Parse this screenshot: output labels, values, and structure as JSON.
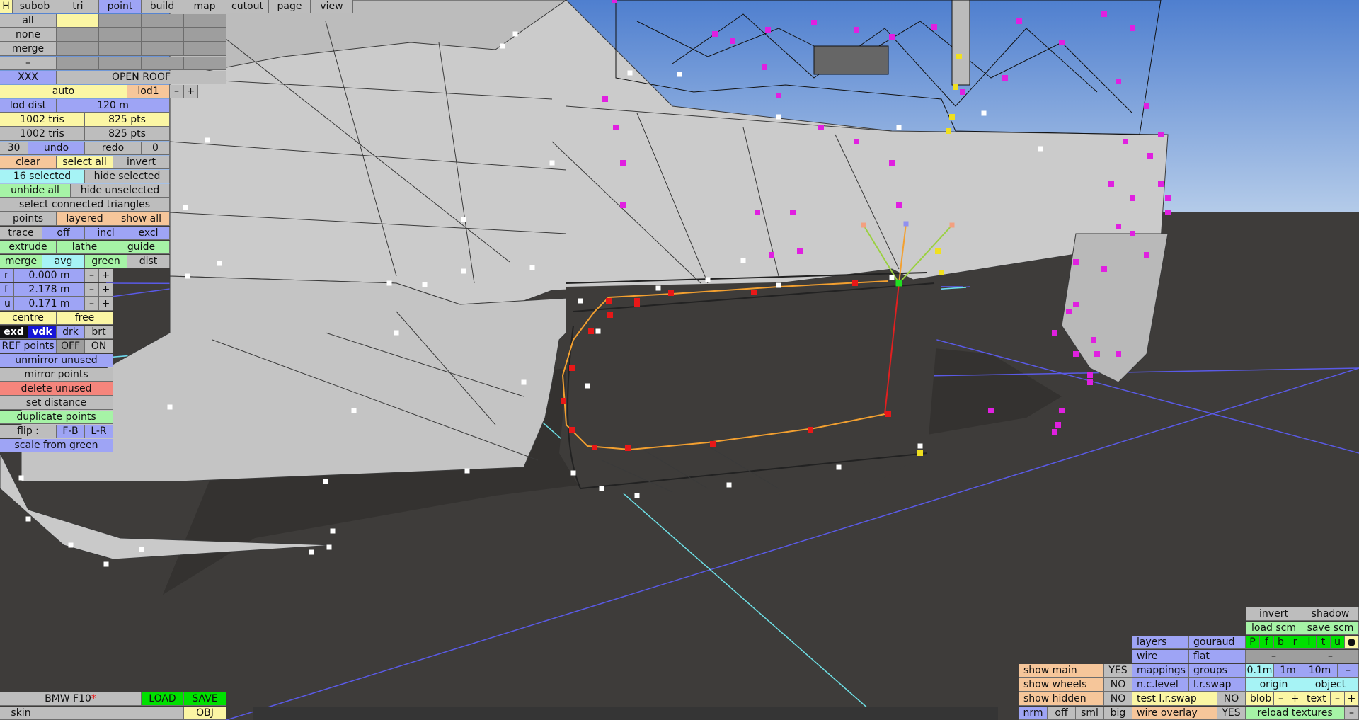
{
  "menu": {
    "h": "H",
    "tabs": [
      "subob",
      "tri",
      "point",
      "build",
      "map",
      "cutout",
      "page",
      "view"
    ]
  },
  "left": {
    "all": "all",
    "none": "none",
    "merge": "merge",
    "dash": "–",
    "xxx": "XXX",
    "open_roof": "OPEN ROOF",
    "auto": "auto",
    "lod1": "lod1",
    "minus": "–",
    "plus": "+",
    "lod_dist": "lod dist",
    "lod_dist_val": "120 m",
    "tris1": "1002 tris",
    "pts1": "825 pts",
    "tris2": "1002 tris",
    "pts2": "825 pts",
    "undo_count": "30",
    "undo": "undo",
    "redo": "redo",
    "redo_count": "0",
    "clear": "clear",
    "select_all": "select all",
    "invert": "invert",
    "selected": "16 selected",
    "hide_selected": "hide selected",
    "unhide_all": "unhide all",
    "hide_unselected": "hide unselected",
    "select_connected": "select connected triangles",
    "points": "points",
    "layered": "layered",
    "show_all": "show all",
    "trace": "trace",
    "off": "off",
    "incl": "incl",
    "excl": "excl",
    "extrude": "extrude",
    "lathe": "lathe",
    "guide": "guide",
    "merge2": "merge",
    "avg": "avg",
    "green": "green",
    "dist": "dist",
    "r": "r",
    "r_val": "0.000 m",
    "f": "f",
    "f_val": "2.178 m",
    "u": "u",
    "u_val": "0.171 m",
    "centre": "centre",
    "free": "free",
    "exd": "exd",
    "vdk": "vdk",
    "drk": "drk",
    "brt": "brt",
    "ref_points": "REF points",
    "ref_off": "OFF",
    "ref_on": "ON",
    "unmirror_unused": "unmirror unused",
    "mirror_points": "mirror points",
    "delete_unused": "delete unused",
    "set_distance": "set distance",
    "duplicate_points": "duplicate points",
    "flip": "flip :",
    "fb": "F-B",
    "lr": "L-R",
    "scale_from_green": "scale from green"
  },
  "bottom_left": {
    "car_name": "BMW F10",
    "star": "*",
    "load": "LOAD",
    "save": "SAVE",
    "skin": "skin",
    "obj": "OBJ"
  },
  "bottom_right": {
    "invert": "invert",
    "shadow": "shadow",
    "load_scm": "load scm",
    "save_scm": "save scm",
    "layers": "layers",
    "gouraud": "gouraud",
    "layer_buttons": [
      "P",
      "f",
      "b",
      "r",
      "l",
      "t",
      "u",
      "●"
    ],
    "wire": "wire",
    "flat": "flat",
    "dash": "–",
    "show_main": "show main",
    "show_main_val": "YES",
    "mappings": "mappings",
    "groups": "groups",
    "m01": "0.1m",
    "m1": "1m",
    "m10": "10m",
    "show_wheels": "show wheels",
    "show_wheels_val": "NO",
    "nc_level": "n.c.level",
    "lr_swap": "l.r.swap",
    "origin": "origin",
    "object": "object",
    "show_hidden": "show hidden",
    "show_hidden_val": "NO",
    "test_lr_swap": "test l.r.swap",
    "test_lr_swap_val": "NO",
    "blob": "blob",
    "text": "text",
    "minus": "–",
    "plus": "+",
    "nrm": "nrm",
    "off": "off",
    "sml": "sml",
    "big": "big",
    "wire_overlay": "wire overlay",
    "wire_overlay_val": "YES",
    "reload_textures": "reload textures"
  },
  "colors": {
    "grey": "#bdbdbd",
    "blue": "#9ea4f5",
    "yellow": "#fbf6a4",
    "orange": "#f6c69a",
    "cyan": "#a6f3f5",
    "green": "#a6f3a6",
    "red": "#f5857c",
    "bright_green": "#00e000",
    "sky": "#6d96d8",
    "ground": "#3e3c3a",
    "mesh": "#c8c8c8",
    "vertex_magenta": "#e020e0"
  }
}
